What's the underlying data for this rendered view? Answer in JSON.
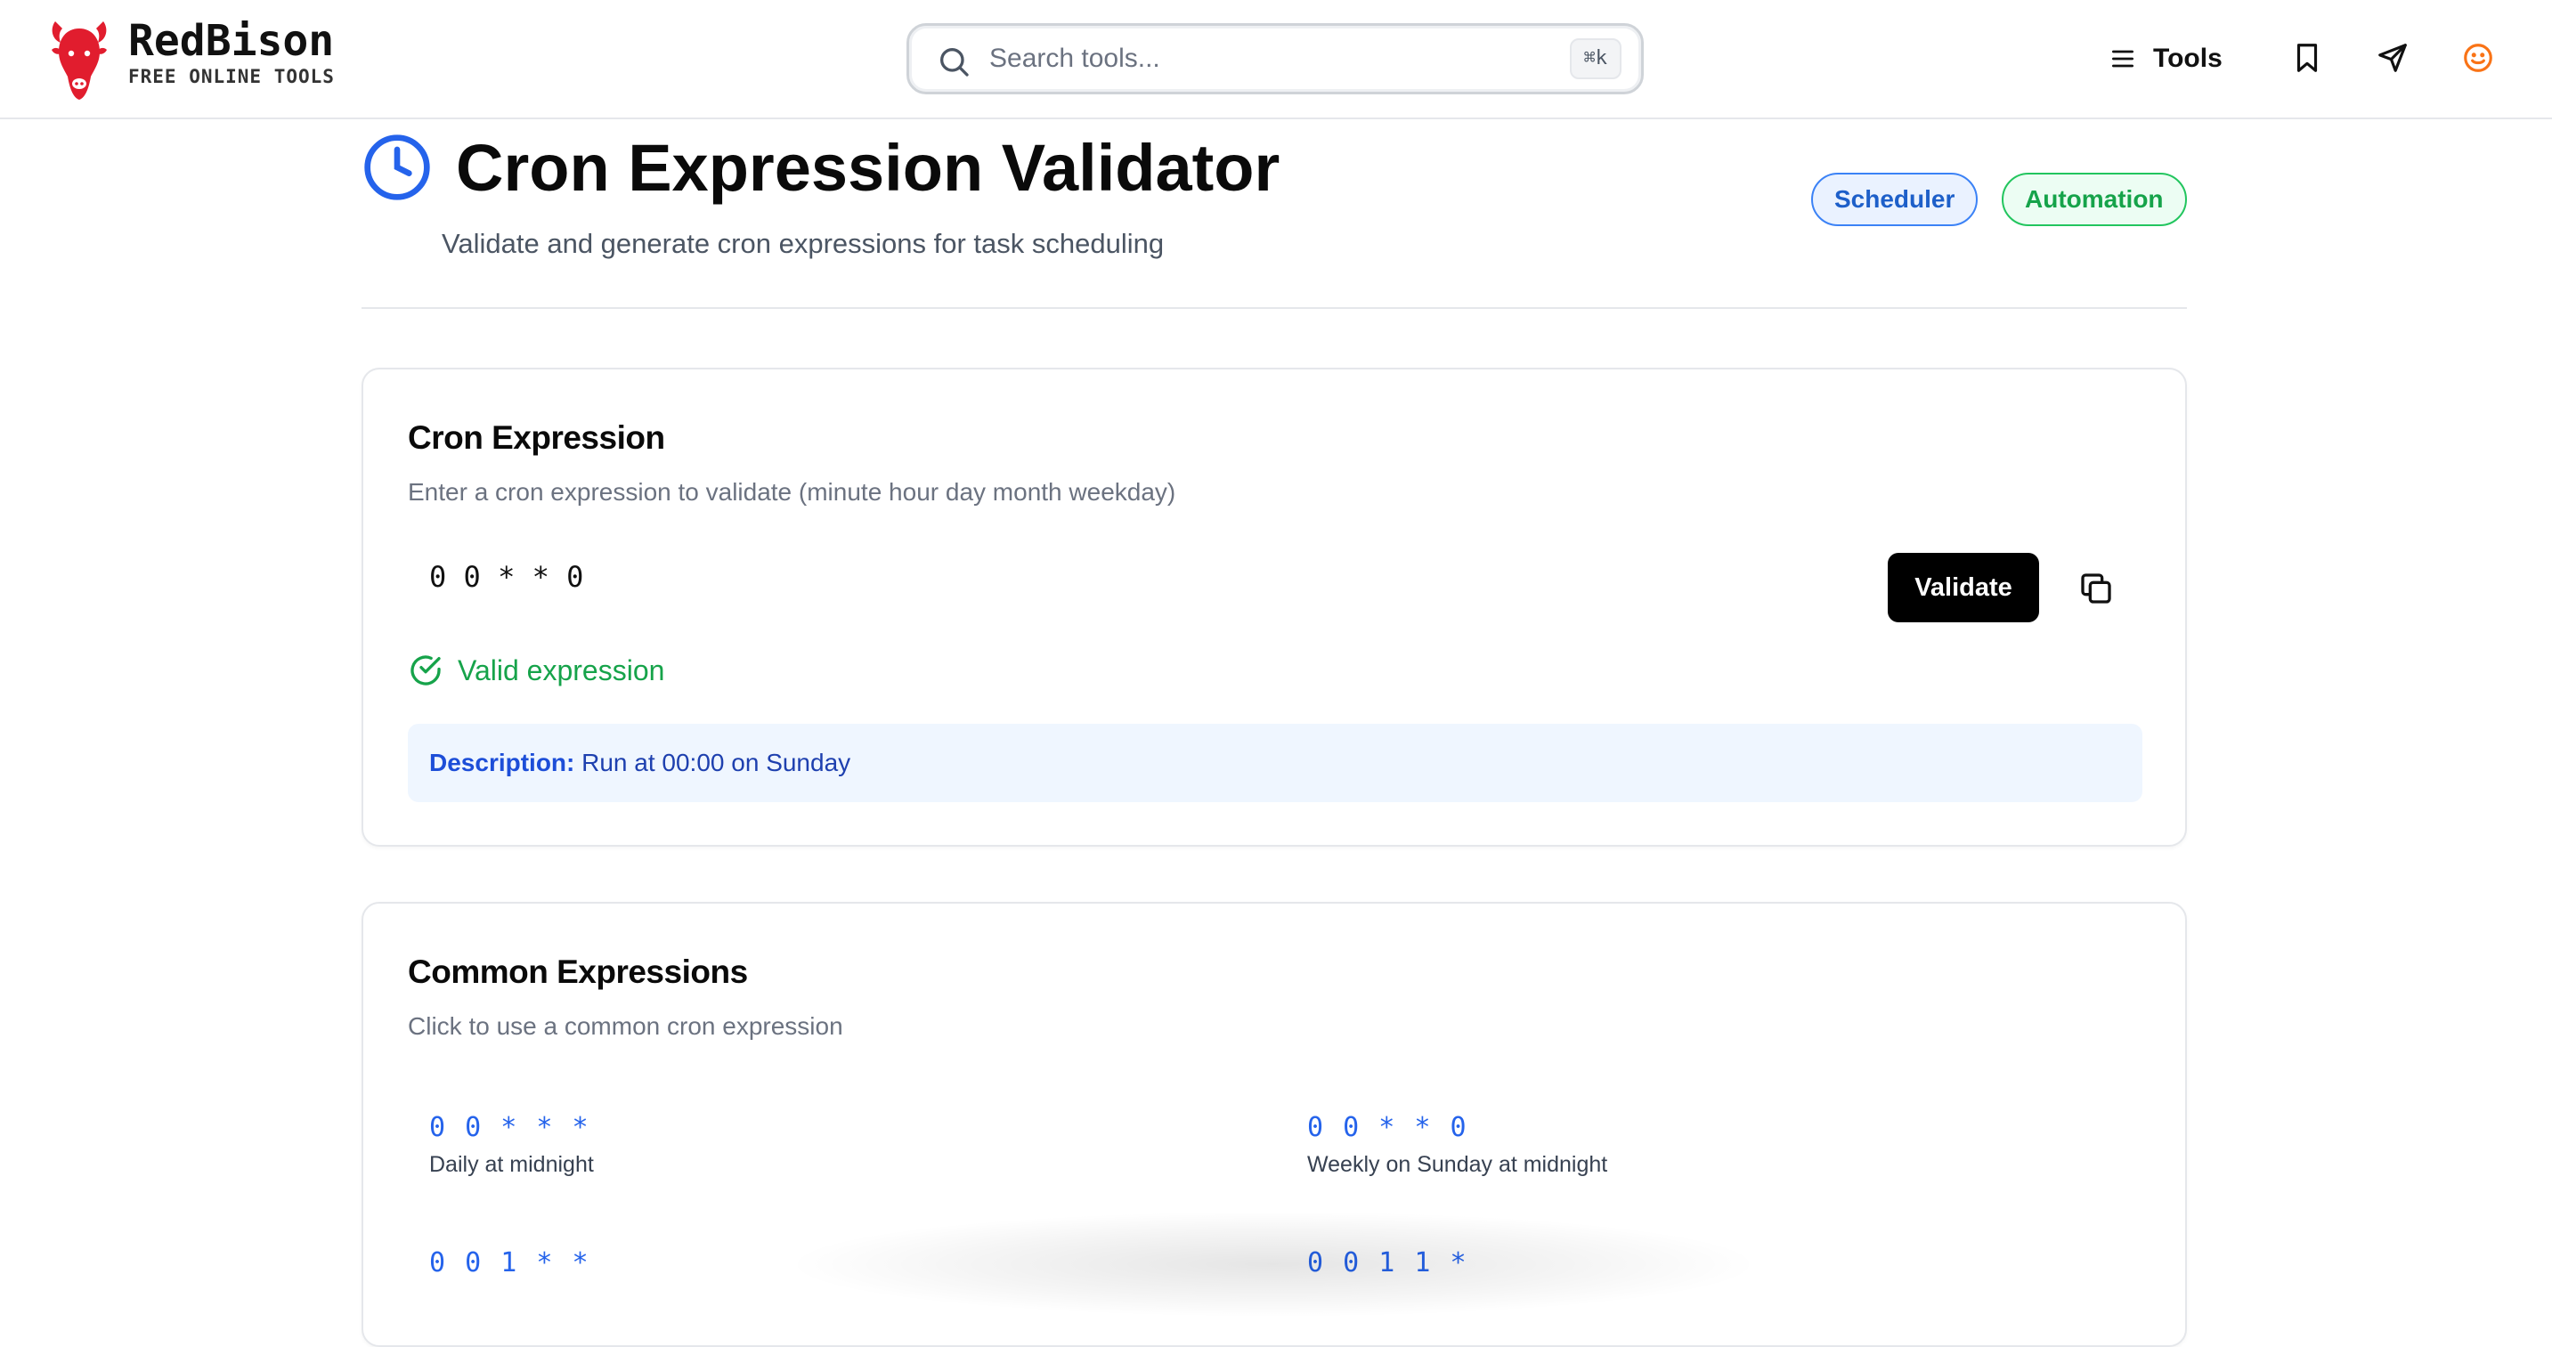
{
  "brand": {
    "name": "RedBison",
    "tagline": "FREE ONLINE TOOLS",
    "color": "#e11d2e"
  },
  "search": {
    "placeholder": "Search tools...",
    "shortcut": "⌘k"
  },
  "nav": {
    "tools_label": "Tools",
    "icons": [
      "menu-icon",
      "bookmark-icon",
      "send-icon",
      "smile-icon"
    ]
  },
  "page": {
    "title": "Cron Expression Validator",
    "subtitle": "Validate and generate cron expressions for task scheduling",
    "title_icon": "clock-icon",
    "badges": [
      {
        "label": "Scheduler",
        "color": "#3b82f6"
      },
      {
        "label": "Automation",
        "color": "#22c55e"
      }
    ]
  },
  "cron_card": {
    "title": "Cron Expression",
    "description": "Enter a cron expression to validate (minute hour day month weekday)",
    "input_value": "0 0 * * 0",
    "validate_label": "Validate",
    "status_text": "Valid expression",
    "status_color": "#16a34a",
    "result_label": "Description:",
    "result_value": "Run at 00:00 on Sunday"
  },
  "common_card": {
    "title": "Common Expressions",
    "description": "Click to use a common cron expression",
    "items": [
      {
        "expression": "0 0 * * *",
        "label": "Daily at midnight"
      },
      {
        "expression": "0 0 * * 0",
        "label": "Weekly on Sunday at midnight"
      },
      {
        "expression": "0 0 1 * *",
        "label": ""
      },
      {
        "expression": "0 0 1 1 *",
        "label": ""
      }
    ]
  },
  "colors": {
    "accent_blue": "#2563eb",
    "success_green": "#16a34a",
    "button_black": "#000000",
    "brand_red": "#e11d2e"
  }
}
